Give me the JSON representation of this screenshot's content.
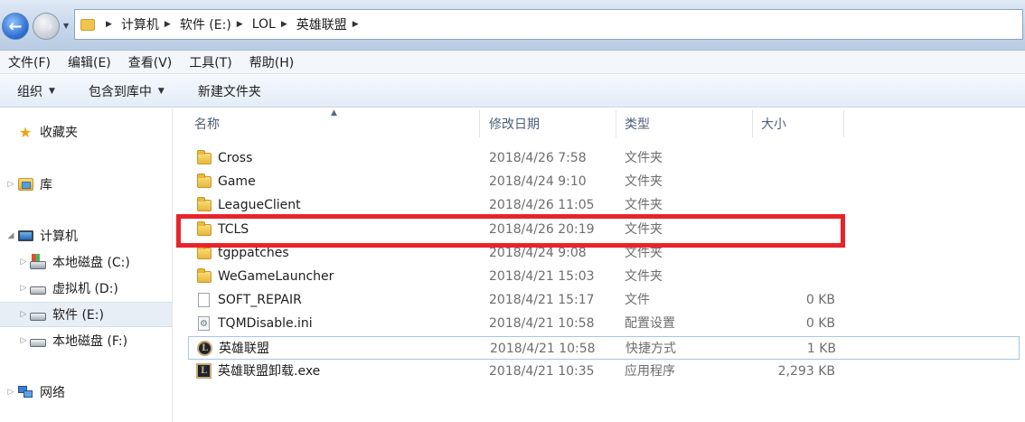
{
  "address_bar": {
    "breadcrumbs": [
      "计算机",
      "软件 (E:)",
      "LOL",
      "英雄联盟"
    ],
    "back_icon": "back-arrow-icon",
    "forward_icon": "forward-arrow-icon"
  },
  "menu": [
    "文件(F)",
    "编辑(E)",
    "查看(V)",
    "工具(T)",
    "帮助(H)"
  ],
  "toolbar": {
    "organize": "组织",
    "include_in_library": "包含到库中",
    "new_folder": "新建文件夹"
  },
  "nav": {
    "favorites": "收藏夹",
    "libraries": "库",
    "computer": "计算机",
    "drives": [
      "本地磁盘 (C:)",
      "虚拟机 (D:)",
      "软件 (E:)",
      "本地磁盘 (F:)"
    ],
    "selected_drive_index": 2,
    "network": "网络"
  },
  "columns": {
    "name": "名称",
    "modified": "修改日期",
    "type": "类型",
    "size": "大小"
  },
  "files": [
    {
      "name": "Cross",
      "modified": "2018/4/26 7:58",
      "type": "文件夹",
      "size": "",
      "icon": "folder-icon"
    },
    {
      "name": "Game",
      "modified": "2018/4/24 9:10",
      "type": "文件夹",
      "size": "",
      "icon": "folder-icon"
    },
    {
      "name": "LeagueClient",
      "modified": "2018/4/26 11:05",
      "type": "文件夹",
      "size": "",
      "icon": "folder-icon"
    },
    {
      "name": "TCLS",
      "modified": "2018/4/26 20:19",
      "type": "文件夹",
      "size": "",
      "icon": "folder-icon"
    },
    {
      "name": "tgppatches",
      "modified": "2018/4/24 9:08",
      "type": "文件夹",
      "size": "",
      "icon": "folder-icon"
    },
    {
      "name": "WeGameLauncher",
      "modified": "2018/4/21 15:03",
      "type": "文件夹",
      "size": "",
      "icon": "folder-icon"
    },
    {
      "name": "SOFT_REPAIR",
      "modified": "2018/4/21 15:17",
      "type": "文件",
      "size": "0 KB",
      "icon": "file-icon"
    },
    {
      "name": "TQMDisable.ini",
      "modified": "2018/4/21 10:58",
      "type": "配置设置",
      "size": "0 KB",
      "icon": "ini-file-icon"
    },
    {
      "name": "英雄联盟",
      "modified": "2018/4/21 10:58",
      "type": "快捷方式",
      "size": "1 KB",
      "icon": "lol-shortcut-icon"
    },
    {
      "name": "英雄联盟卸载.exe",
      "modified": "2018/4/21 10:35",
      "type": "应用程序",
      "size": "2,293 KB",
      "icon": "lol-exe-icon"
    }
  ],
  "highlight_color": "#e8242b"
}
